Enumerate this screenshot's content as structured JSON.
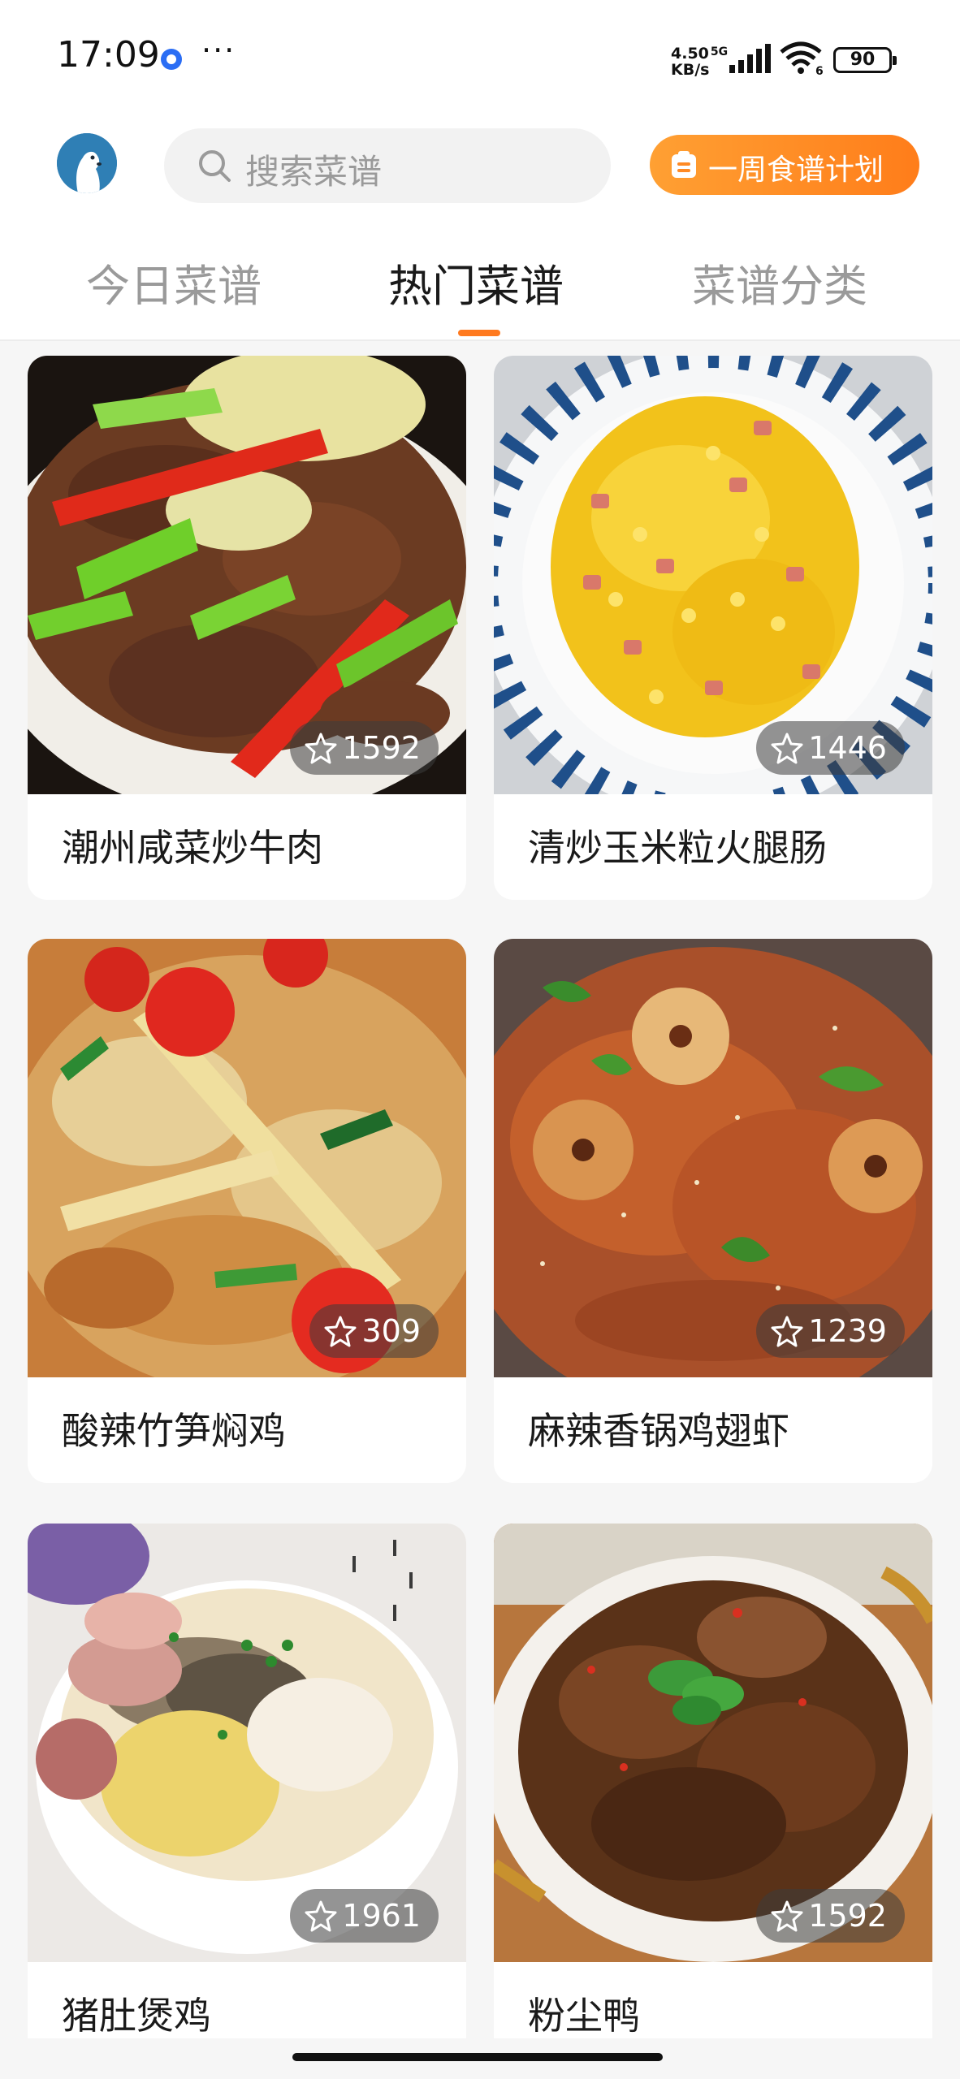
{
  "status_bar": {
    "time": "17:09",
    "more": "···",
    "net_speed_value": "4.50",
    "net_speed_unit": "KB/s",
    "network_type": "5G",
    "wifi_level": "6",
    "battery": "90"
  },
  "header": {
    "search_placeholder": "搜索菜谱",
    "plan_button_label": "一周食谱计划",
    "avatar_icon": "seal-avatar-icon"
  },
  "tabs": [
    {
      "label": "今日菜谱",
      "active": false
    },
    {
      "label": "热门菜谱",
      "active": true
    },
    {
      "label": "菜谱分类",
      "active": false
    }
  ],
  "accent_color": "#ff7a1f",
  "recipes": [
    {
      "title": "潮州咸菜炒牛肉",
      "favorites": "1592"
    },
    {
      "title": "清炒玉米粒火腿肠",
      "favorites": "1446"
    },
    {
      "title": "酸辣竹笋焖鸡",
      "favorites": "309"
    },
    {
      "title": "麻辣香锅鸡翅虾",
      "favorites": "1239"
    },
    {
      "title": "猪肚煲鸡",
      "favorites": "1961"
    },
    {
      "title": "粉尘鸭",
      "favorites": "1592"
    }
  ]
}
